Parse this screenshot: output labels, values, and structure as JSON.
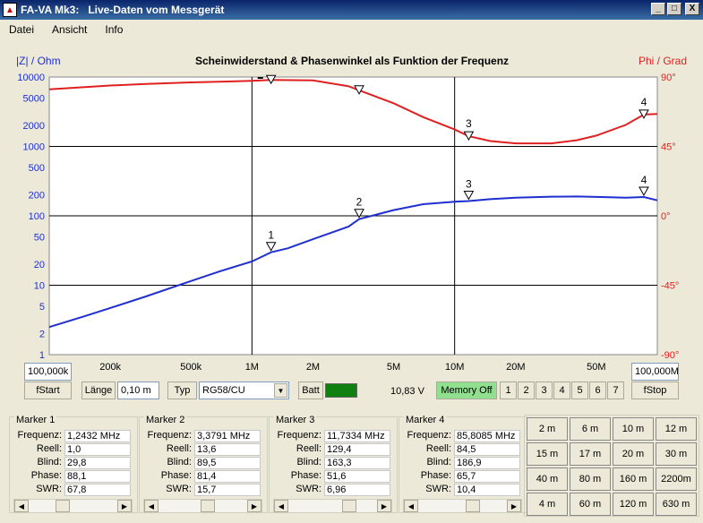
{
  "window": {
    "title": "FA-VA Mk3:",
    "subtitle": "Live-Daten vom Messgerät",
    "min": "_",
    "max": "□",
    "close": "X"
  },
  "menu": [
    "Datei",
    "Ansicht",
    "Info"
  ],
  "chart": {
    "title": "Scheinwiderstand & Phasenwinkel als Funktion der Frequenz",
    "left_label": "|Z| / Ohm",
    "right_label": "Phi / Grad",
    "left_ticks": [
      "10000",
      "5000",
      "2000",
      "1000",
      "500",
      "200",
      "100",
      "50",
      "20",
      "10",
      "5",
      "2",
      "1"
    ],
    "right_ticks": [
      "90°",
      "45°",
      "0°",
      "-45°",
      "-90°"
    ],
    "x_ticks": [
      "200k",
      "500k",
      "1M",
      "2M",
      "5M",
      "10M",
      "20M",
      "50M"
    ],
    "marker_labels_z": [
      "1",
      "2",
      "3",
      "4"
    ],
    "marker_labels_phi": [
      "3",
      "4"
    ]
  },
  "chart_data": {
    "type": "line",
    "title": "Scheinwiderstand & Phasenwinkel als Funktion der Frequenz",
    "x_scale": "log",
    "x_unit": "Hz",
    "xlim": [
      100000,
      100000000
    ],
    "y_left": {
      "label": "|Z| / Ohm",
      "scale": "log",
      "lim": [
        1,
        10000
      ]
    },
    "y_right": {
      "label": "Phi / Grad",
      "lim": [
        -90,
        90
      ]
    },
    "series": [
      {
        "axis": "left",
        "color": "#1f2fd0",
        "x": [
          100000,
          150000,
          200000,
          300000,
          500000,
          700000,
          1000000,
          1242300,
          1500000,
          2000000,
          3000000,
          3379100,
          5000000,
          7000000,
          10000000,
          11733400,
          15000000,
          20000000,
          30000000,
          40000000,
          50000000,
          70000000,
          85808500,
          100000000
        ],
        "y": [
          2.5,
          3.6,
          4.7,
          6.9,
          11.5,
          16,
          22,
          29.8,
          34,
          46,
          70,
          89.5,
          121,
          147,
          160,
          163.3,
          174,
          183,
          189,
          190,
          187,
          182,
          186.9,
          167
        ]
      },
      {
        "axis": "right",
        "color": "#e02020",
        "x": [
          100000,
          150000,
          200000,
          300000,
          500000,
          1000000,
          1242300,
          2000000,
          3000000,
          3379100,
          5000000,
          7000000,
          10000000,
          11733400,
          15000000,
          20000000,
          30000000,
          40000000,
          50000000,
          70000000,
          85808500,
          100000000
        ],
        "y": [
          82,
          83.5,
          84.5,
          85.5,
          86.5,
          87.5,
          88.1,
          87.8,
          84,
          81.4,
          73,
          64,
          56,
          51.6,
          48.5,
          47,
          47,
          49,
          52,
          59,
          65.7,
          66
        ]
      }
    ],
    "markers": [
      {
        "label": "1",
        "x": 1242300,
        "z": 29.8,
        "phi": 88.1
      },
      {
        "label": "2",
        "x": 3379100,
        "z": 89.5,
        "phi": 81.4
      },
      {
        "label": "3",
        "x": 11733400,
        "z": 163.3,
        "phi": 51.6
      },
      {
        "label": "4",
        "x": 85808500,
        "z": 186.9,
        "phi": 65.7
      }
    ]
  },
  "controls": {
    "fstart_value": "100,000k",
    "fstart_label": "fStart",
    "laenge_label": "Länge",
    "laenge_value": "0,10 m",
    "typ_label": "Typ",
    "typ_value": "RG58/CU",
    "batt_label": "Batt",
    "batt_value": "10,83 V",
    "memory_label": "Memory Off",
    "memory_slots": [
      "1",
      "2",
      "3",
      "4",
      "5",
      "6",
      "7"
    ],
    "fstop_value": "100,000M",
    "fstop_label": "fStop"
  },
  "marker_labels": {
    "freq": "Frequenz:",
    "real": "Reell:",
    "blind": "Blind:",
    "phase": "Phase:",
    "swr": "SWR:"
  },
  "markers": [
    {
      "title": "Marker 1",
      "freq": "1,2432 MHz",
      "real": "1,0",
      "blind": "29,8",
      "phase": "88,1",
      "swr": "67,8"
    },
    {
      "title": "Marker 2",
      "freq": "3,3791 MHz",
      "real": "13,6",
      "blind": "89,5",
      "phase": "81,4",
      "swr": "15,7"
    },
    {
      "title": "Marker 3",
      "freq": "11,7334 MHz",
      "real": "129,4",
      "blind": "163,3",
      "phase": "51,6",
      "swr": "6,96"
    },
    {
      "title": "Marker 4",
      "freq": "85,8085 MHz",
      "real": "84,5",
      "blind": "186,9",
      "phase": "65,7",
      "swr": "10,4"
    }
  ],
  "marker_slider_positions": [
    0.35,
    0.55,
    0.7,
    0.62
  ],
  "length_buttons": [
    "2 m",
    "6 m",
    "10 m",
    "12 m",
    "15 m",
    "17 m",
    "20 m",
    "30 m",
    "40 m",
    "80 m",
    "160 m",
    "2200m",
    "4 m",
    "60 m",
    "120 m",
    "630 m"
  ]
}
